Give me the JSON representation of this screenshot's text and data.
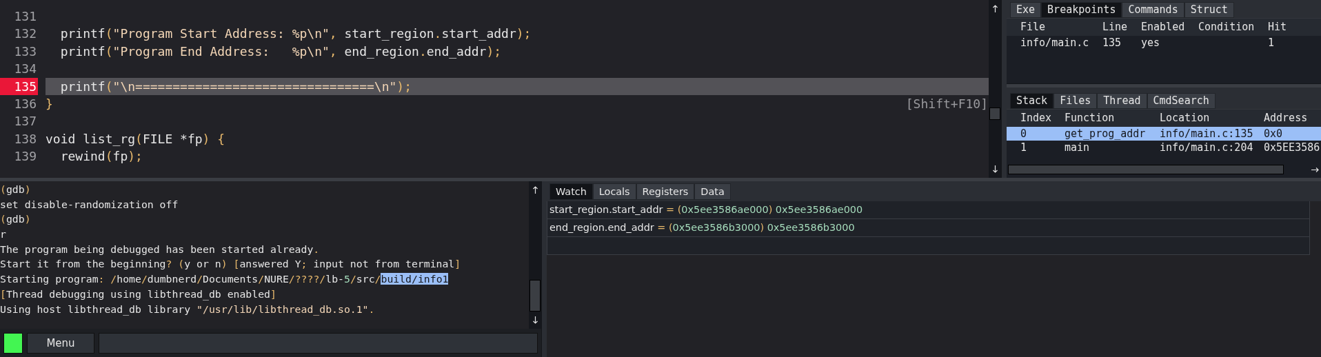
{
  "editor": {
    "lines": [
      {
        "number": "131",
        "breakpoint": false,
        "current": false
      },
      {
        "number": "132",
        "breakpoint": false,
        "current": false,
        "tokens": [
          {
            "kind": "plain",
            "text": "  printf"
          },
          {
            "kind": "punct",
            "text": "("
          },
          {
            "kind": "string",
            "text": "\"Program Start Address: %p\\n\""
          },
          {
            "kind": "punct",
            "text": ", "
          },
          {
            "kind": "plain",
            "text": "start_region"
          },
          {
            "kind": "punct",
            "text": "."
          },
          {
            "kind": "plain",
            "text": "start_addr"
          },
          {
            "kind": "punct",
            "text": ");"
          }
        ]
      },
      {
        "number": "133",
        "breakpoint": false,
        "current": false,
        "tokens": [
          {
            "kind": "plain",
            "text": "  printf"
          },
          {
            "kind": "punct",
            "text": "("
          },
          {
            "kind": "string",
            "text": "\"Program End Address:   %p\\n\""
          },
          {
            "kind": "punct",
            "text": ", "
          },
          {
            "kind": "plain",
            "text": "end_region"
          },
          {
            "kind": "punct",
            "text": "."
          },
          {
            "kind": "plain",
            "text": "end_addr"
          },
          {
            "kind": "punct",
            "text": ");"
          }
        ]
      },
      {
        "number": "134",
        "breakpoint": false,
        "current": false
      },
      {
        "number": "135",
        "breakpoint": true,
        "current": true,
        "tokens": [
          {
            "kind": "plain",
            "text": "  printf"
          },
          {
            "kind": "punct",
            "text": "("
          },
          {
            "kind": "string",
            "text": "\"\\n================================\\n\""
          },
          {
            "kind": "punct",
            "text": ");"
          }
        ]
      },
      {
        "number": "136",
        "breakpoint": false,
        "current": false,
        "tokens": [
          {
            "kind": "punct",
            "text": "}"
          }
        ],
        "hint": "[Shift+F10]"
      },
      {
        "number": "137",
        "breakpoint": false,
        "current": false
      },
      {
        "number": "138",
        "breakpoint": false,
        "current": false,
        "tokens": [
          {
            "kind": "plain",
            "text": "void list_rg"
          },
          {
            "kind": "punct",
            "text": "("
          },
          {
            "kind": "plain",
            "text": "FILE *fp"
          },
          {
            "kind": "punct",
            "text": ") {"
          }
        ]
      },
      {
        "number": "139",
        "breakpoint": false,
        "current": false,
        "tokens": [
          {
            "kind": "plain",
            "text": "  rewind"
          },
          {
            "kind": "punct",
            "text": "("
          },
          {
            "kind": "plain",
            "text": "fp"
          },
          {
            "kind": "punct",
            "text": ");"
          }
        ]
      }
    ]
  },
  "breakpoints_panel": {
    "tabs": [
      {
        "label": "Exe",
        "selected": false
      },
      {
        "label": "Breakpoints",
        "selected": true
      },
      {
        "label": "Commands",
        "selected": false
      },
      {
        "label": "Struct",
        "selected": false
      }
    ],
    "columns": [
      "File",
      "Line",
      "Enabled",
      "Condition",
      "Hit"
    ],
    "rows": [
      {
        "cells": [
          "info/main.c",
          "135",
          "yes",
          null,
          "1"
        ]
      }
    ]
  },
  "stack_panel": {
    "tabs": [
      {
        "label": "Stack",
        "selected": true
      },
      {
        "label": "Files",
        "selected": false
      },
      {
        "label": "Thread",
        "selected": false
      },
      {
        "label": "CmdSearch",
        "selected": false
      }
    ],
    "columns": [
      "Index",
      "Function",
      "Location",
      "Address"
    ],
    "rows": [
      {
        "cells": [
          "0",
          "get_prog_addr",
          "info/main.c:135",
          "0x0"
        ],
        "selected": true
      },
      {
        "cells": [
          "1",
          "main",
          "info/main.c:204",
          "0x5EE3586"
        ],
        "selected": false
      }
    ]
  },
  "console": {
    "lines": [
      {
        "tokens": [
          {
            "kind": "punct",
            "text": "("
          },
          {
            "kind": "plain",
            "text": "gdb"
          },
          {
            "kind": "punct",
            "text": ")"
          }
        ]
      },
      {
        "tokens": [
          {
            "kind": "plain",
            "text": "set disable-randomization off"
          }
        ]
      },
      {
        "tokens": [
          {
            "kind": "punct",
            "text": "("
          },
          {
            "kind": "plain",
            "text": "gdb"
          },
          {
            "kind": "punct",
            "text": ")"
          }
        ]
      },
      {
        "tokens": [
          {
            "kind": "plain",
            "text": "r"
          }
        ]
      },
      {
        "tokens": [
          {
            "kind": "plain",
            "text": "The program being debugged has been started already"
          },
          {
            "kind": "punct",
            "text": "."
          }
        ]
      },
      {
        "tokens": [
          {
            "kind": "plain",
            "text": "Start it from the beginning"
          },
          {
            "kind": "punct",
            "text": "? ("
          },
          {
            "kind": "plain",
            "text": "y or n"
          },
          {
            "kind": "punct",
            "text": ") ["
          },
          {
            "kind": "plain",
            "text": "answered Y"
          },
          {
            "kind": "punct",
            "text": ";"
          },
          {
            "kind": "plain",
            "text": " input not from terminal"
          },
          {
            "kind": "punct",
            "text": "]"
          }
        ]
      },
      {
        "tokens": [
          {
            "kind": "plain",
            "text": "Starting program"
          },
          {
            "kind": "punct",
            "text": ": /"
          },
          {
            "kind": "plain",
            "text": "home"
          },
          {
            "kind": "punct",
            "text": "/"
          },
          {
            "kind": "plain",
            "text": "dumbnerd"
          },
          {
            "kind": "punct",
            "text": "/"
          },
          {
            "kind": "plain",
            "text": "Documents"
          },
          {
            "kind": "punct",
            "text": "/"
          },
          {
            "kind": "plain",
            "text": "NURE"
          },
          {
            "kind": "punct",
            "text": "/????/"
          },
          {
            "kind": "plain",
            "text": "lb-"
          },
          {
            "kind": "num",
            "text": "5"
          },
          {
            "kind": "punct",
            "text": "/"
          },
          {
            "kind": "plain",
            "text": "src"
          },
          {
            "kind": "punct",
            "text": "/"
          },
          {
            "kind": "sel",
            "text": "build/info1"
          }
        ]
      },
      {
        "tokens": [
          {
            "kind": "punct",
            "text": "["
          },
          {
            "kind": "plain",
            "text": "Thread debugging using libthread_db enabled"
          },
          {
            "kind": "punct",
            "text": "]"
          }
        ]
      },
      {
        "tokens": [
          {
            "kind": "plain",
            "text": "Using host libthread_db library "
          },
          {
            "kind": "string",
            "text": "\"/usr/lib/libthread_db.so.1\""
          },
          {
            "kind": "punct",
            "text": "."
          }
        ]
      }
    ],
    "menu_button": "Menu"
  },
  "watch_panel": {
    "tabs": [
      {
        "label": "Watch",
        "selected": true
      },
      {
        "label": "Locals",
        "selected": false
      },
      {
        "label": "Registers",
        "selected": false
      },
      {
        "label": "Data",
        "selected": false
      }
    ],
    "rows": [
      {
        "tokens": [
          {
            "kind": "plain",
            "text": "start_region.start_addr "
          },
          {
            "kind": "punct",
            "text": "= ("
          },
          {
            "kind": "num",
            "text": "0x5ee3586ae000"
          },
          {
            "kind": "punct",
            "text": ") "
          },
          {
            "kind": "num",
            "text": "0x5ee3586ae000"
          }
        ]
      },
      {
        "tokens": [
          {
            "kind": "plain",
            "text": "end_region.end_addr "
          },
          {
            "kind": "punct",
            "text": "= ("
          },
          {
            "kind": "num",
            "text": "0x5ee3586b3000"
          },
          {
            "kind": "punct",
            "text": ") "
          },
          {
            "kind": "num",
            "text": "0x5ee3586b3000"
          }
        ]
      }
    ]
  }
}
